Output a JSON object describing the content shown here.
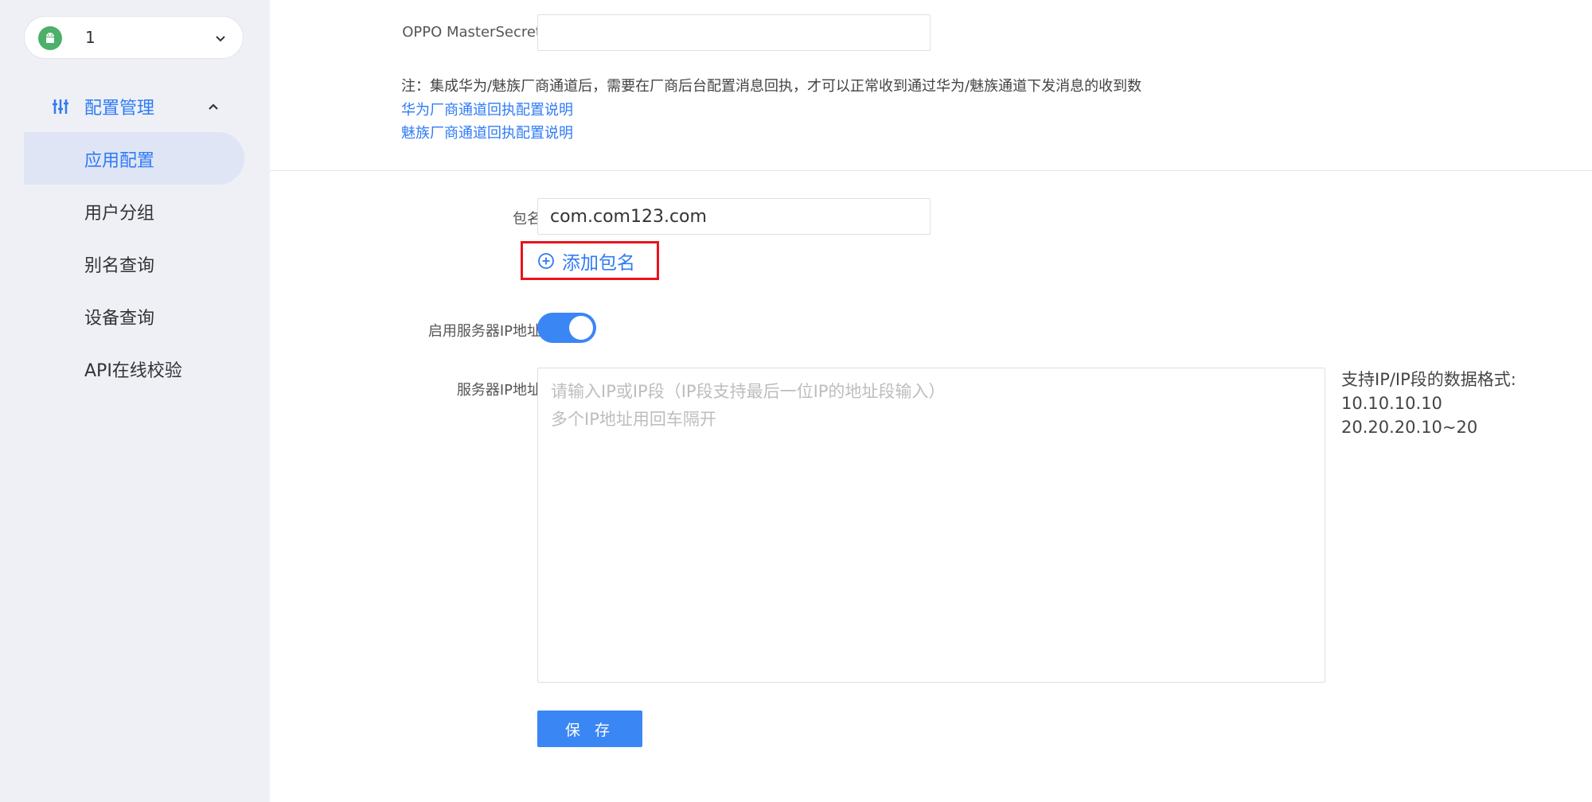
{
  "sidebar": {
    "app_selector": {
      "name": "1",
      "icon": "android-icon"
    },
    "group": {
      "label": "配置管理",
      "icon": "sliders-icon",
      "expanded": true
    },
    "items": [
      {
        "label": "应用配置",
        "active": true
      },
      {
        "label": "用户分组",
        "active": false
      },
      {
        "label": "别名查询",
        "active": false
      },
      {
        "label": "设备查询",
        "active": false
      },
      {
        "label": "API在线校验",
        "active": false
      }
    ]
  },
  "main": {
    "oppo_master_secret": {
      "label": "OPPO MasterSecret",
      "value": ""
    },
    "note": "注：集成华为/魅族厂商通道后，需要在厂商后台配置消息回执，才可以正常收到通过华为/魅族通道下发消息的收到数",
    "links": {
      "huawei": "华为厂商通道回执配置说明",
      "meizu": "魅族厂商通道回执配置说明"
    },
    "package_name": {
      "label": "包名",
      "value": "com.com123.com"
    },
    "add_package": {
      "label": "添加包名",
      "icon": "plus-circle-icon"
    },
    "server_ip_toggle": {
      "label": "启用服务器IP地址",
      "enabled": true
    },
    "server_ip": {
      "label": "服务器IP地址",
      "placeholder": "请输入IP或IP段（IP段支持最后一位IP的地址段输入）\n多个IP地址用回车隔开",
      "value": ""
    },
    "hint": {
      "title": "支持IP/IP段的数据格式:",
      "example1": "10.10.10.10",
      "example2": "20.20.20.10~20"
    },
    "save_label": "保 存"
  },
  "colors": {
    "accent": "#2f7bf5",
    "toggle_on": "#3b86f5",
    "highlight_box": "#e8141c",
    "sidebar_bg": "#eef0f6",
    "android_green": "#4caf6a"
  }
}
